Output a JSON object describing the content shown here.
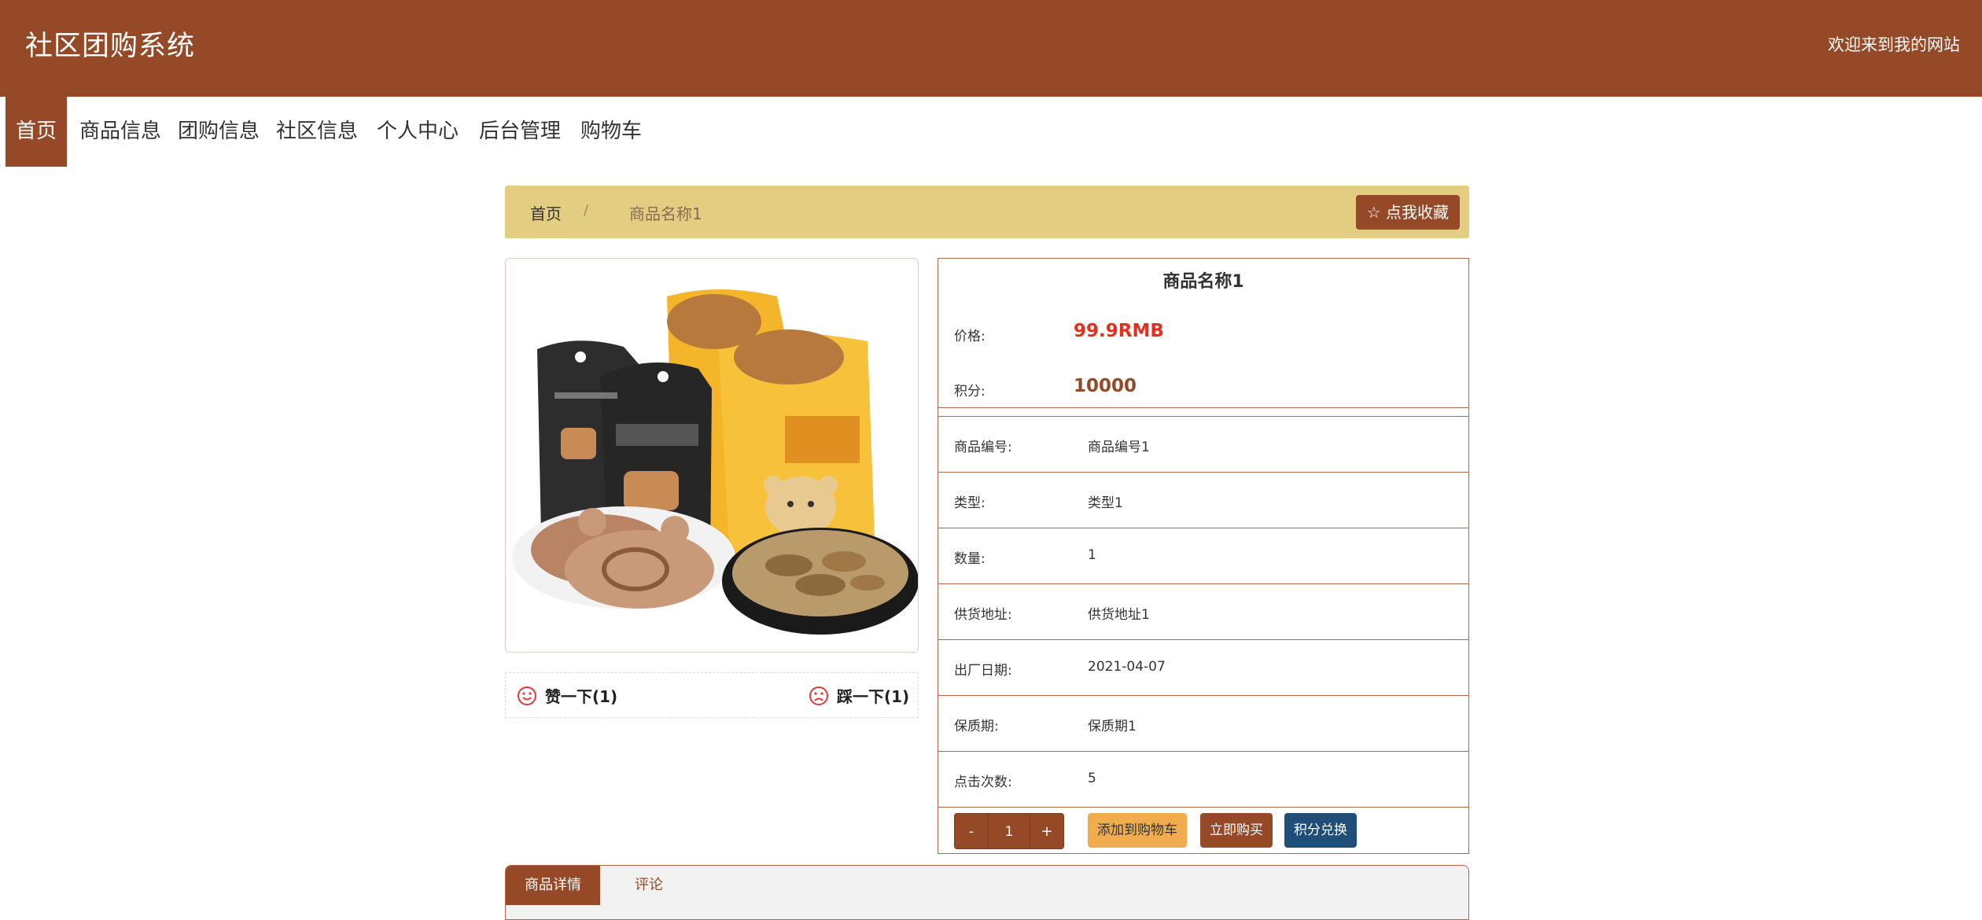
{
  "header": {
    "site_title": "社区团购系统",
    "welcome": "欢迎来到我的网站"
  },
  "nav": {
    "items": [
      {
        "label": "首页",
        "active": true
      },
      {
        "label": "商品信息"
      },
      {
        "label": "团购信息"
      },
      {
        "label": "社区信息"
      },
      {
        "label": "个人中心"
      },
      {
        "label": "后台管理"
      },
      {
        "label": "购物车"
      }
    ]
  },
  "breadcrumb": {
    "home": "首页",
    "separator": "/",
    "current": "商品名称1",
    "favorite_label": "点我收藏"
  },
  "rating": {
    "like_label": "赞一下(1)",
    "dislike_label": "踩一下(1)"
  },
  "product": {
    "name": "商品名称1",
    "rows": [
      {
        "label": "价格:",
        "value": "99.9RMB"
      },
      {
        "label": "积分:",
        "value": "10000"
      },
      {
        "label": "商品编号:",
        "value": "商品编号1"
      },
      {
        "label": "类型:",
        "value": "类型1"
      },
      {
        "label": "数量:",
        "value": "1"
      },
      {
        "label": "供货地址:",
        "value": "供货地址1"
      },
      {
        "label": "出厂日期:",
        "value": "2021-04-07"
      },
      {
        "label": "保质期:",
        "value": "保质期1"
      },
      {
        "label": "点击次数:",
        "value": "5"
      }
    ]
  },
  "purchase": {
    "minus": "-",
    "quantity": "1",
    "plus": "+",
    "add_to_cart": "添加到购物车",
    "buy_now": "立即购买",
    "points_exchange": "积分兑换"
  },
  "tabs": [
    {
      "label": "商品详情",
      "active": true
    },
    {
      "label": "评论"
    }
  ],
  "colors": {
    "brand": "#954927",
    "breadcrumb_bg": "#e3cd80",
    "price": "#e62e1e",
    "cart_button": "#f0ad4e",
    "points_button": "#1f4e79"
  }
}
